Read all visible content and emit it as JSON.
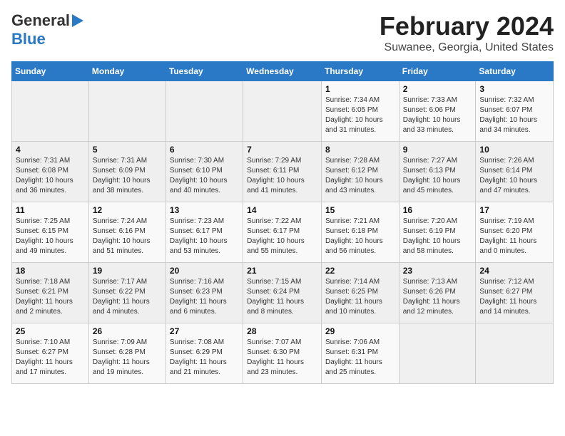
{
  "logo": {
    "line1": "General",
    "line2": "Blue"
  },
  "title": "February 2024",
  "subtitle": "Suwanee, Georgia, United States",
  "days_of_week": [
    "Sunday",
    "Monday",
    "Tuesday",
    "Wednesday",
    "Thursday",
    "Friday",
    "Saturday"
  ],
  "weeks": [
    [
      {
        "day": "",
        "info": ""
      },
      {
        "day": "",
        "info": ""
      },
      {
        "day": "",
        "info": ""
      },
      {
        "day": "",
        "info": ""
      },
      {
        "day": "1",
        "info": "Sunrise: 7:34 AM\nSunset: 6:05 PM\nDaylight: 10 hours and 31 minutes."
      },
      {
        "day": "2",
        "info": "Sunrise: 7:33 AM\nSunset: 6:06 PM\nDaylight: 10 hours and 33 minutes."
      },
      {
        "day": "3",
        "info": "Sunrise: 7:32 AM\nSunset: 6:07 PM\nDaylight: 10 hours and 34 minutes."
      }
    ],
    [
      {
        "day": "4",
        "info": "Sunrise: 7:31 AM\nSunset: 6:08 PM\nDaylight: 10 hours and 36 minutes."
      },
      {
        "day": "5",
        "info": "Sunrise: 7:31 AM\nSunset: 6:09 PM\nDaylight: 10 hours and 38 minutes."
      },
      {
        "day": "6",
        "info": "Sunrise: 7:30 AM\nSunset: 6:10 PM\nDaylight: 10 hours and 40 minutes."
      },
      {
        "day": "7",
        "info": "Sunrise: 7:29 AM\nSunset: 6:11 PM\nDaylight: 10 hours and 41 minutes."
      },
      {
        "day": "8",
        "info": "Sunrise: 7:28 AM\nSunset: 6:12 PM\nDaylight: 10 hours and 43 minutes."
      },
      {
        "day": "9",
        "info": "Sunrise: 7:27 AM\nSunset: 6:13 PM\nDaylight: 10 hours and 45 minutes."
      },
      {
        "day": "10",
        "info": "Sunrise: 7:26 AM\nSunset: 6:14 PM\nDaylight: 10 hours and 47 minutes."
      }
    ],
    [
      {
        "day": "11",
        "info": "Sunrise: 7:25 AM\nSunset: 6:15 PM\nDaylight: 10 hours and 49 minutes."
      },
      {
        "day": "12",
        "info": "Sunrise: 7:24 AM\nSunset: 6:16 PM\nDaylight: 10 hours and 51 minutes."
      },
      {
        "day": "13",
        "info": "Sunrise: 7:23 AM\nSunset: 6:17 PM\nDaylight: 10 hours and 53 minutes."
      },
      {
        "day": "14",
        "info": "Sunrise: 7:22 AM\nSunset: 6:17 PM\nDaylight: 10 hours and 55 minutes."
      },
      {
        "day": "15",
        "info": "Sunrise: 7:21 AM\nSunset: 6:18 PM\nDaylight: 10 hours and 56 minutes."
      },
      {
        "day": "16",
        "info": "Sunrise: 7:20 AM\nSunset: 6:19 PM\nDaylight: 10 hours and 58 minutes."
      },
      {
        "day": "17",
        "info": "Sunrise: 7:19 AM\nSunset: 6:20 PM\nDaylight: 11 hours and 0 minutes."
      }
    ],
    [
      {
        "day": "18",
        "info": "Sunrise: 7:18 AM\nSunset: 6:21 PM\nDaylight: 11 hours and 2 minutes."
      },
      {
        "day": "19",
        "info": "Sunrise: 7:17 AM\nSunset: 6:22 PM\nDaylight: 11 hours and 4 minutes."
      },
      {
        "day": "20",
        "info": "Sunrise: 7:16 AM\nSunset: 6:23 PM\nDaylight: 11 hours and 6 minutes."
      },
      {
        "day": "21",
        "info": "Sunrise: 7:15 AM\nSunset: 6:24 PM\nDaylight: 11 hours and 8 minutes."
      },
      {
        "day": "22",
        "info": "Sunrise: 7:14 AM\nSunset: 6:25 PM\nDaylight: 11 hours and 10 minutes."
      },
      {
        "day": "23",
        "info": "Sunrise: 7:13 AM\nSunset: 6:26 PM\nDaylight: 11 hours and 12 minutes."
      },
      {
        "day": "24",
        "info": "Sunrise: 7:12 AM\nSunset: 6:27 PM\nDaylight: 11 hours and 14 minutes."
      }
    ],
    [
      {
        "day": "25",
        "info": "Sunrise: 7:10 AM\nSunset: 6:27 PM\nDaylight: 11 hours and 17 minutes."
      },
      {
        "day": "26",
        "info": "Sunrise: 7:09 AM\nSunset: 6:28 PM\nDaylight: 11 hours and 19 minutes."
      },
      {
        "day": "27",
        "info": "Sunrise: 7:08 AM\nSunset: 6:29 PM\nDaylight: 11 hours and 21 minutes."
      },
      {
        "day": "28",
        "info": "Sunrise: 7:07 AM\nSunset: 6:30 PM\nDaylight: 11 hours and 23 minutes."
      },
      {
        "day": "29",
        "info": "Sunrise: 7:06 AM\nSunset: 6:31 PM\nDaylight: 11 hours and 25 minutes."
      },
      {
        "day": "",
        "info": ""
      },
      {
        "day": "",
        "info": ""
      }
    ]
  ]
}
